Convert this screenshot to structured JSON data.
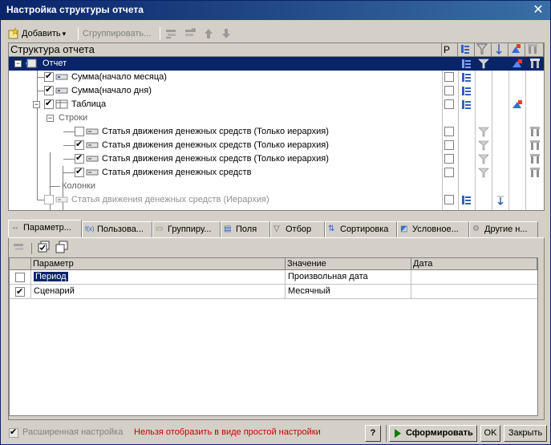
{
  "window": {
    "title": "Настройка структуры отчета",
    "close_glyph": "✕"
  },
  "toolbar": {
    "add_label": "Добавить",
    "add_arrow": "▾",
    "group_label": "Сгруппировать..."
  },
  "tree": {
    "header": {
      "title": "Структура отчета",
      "col_r": "Р"
    },
    "rows": [
      {
        "label": "Отчет",
        "level": 0,
        "checked": null,
        "selected": true
      },
      {
        "label": "Сумма(начало месяца)",
        "level": 1,
        "checked": true
      },
      {
        "label": "Сумма(начало дня)",
        "level": 1,
        "checked": true
      },
      {
        "label": "Таблица",
        "level": 1,
        "checked": true
      },
      {
        "label": "Строки",
        "level": 2,
        "checked": null
      },
      {
        "label": "Статья движения денежных средств (Только иерархия)",
        "level": 3,
        "checked": false
      },
      {
        "label": "Статья движения денежных средств (Только иерархия)",
        "level": 3,
        "checked": true
      },
      {
        "label": "Статья движения денежных средств (Только иерархия)",
        "level": 3,
        "checked": true
      },
      {
        "label": "Статья движения денежных средств",
        "level": 3,
        "checked": true
      },
      {
        "label": "Колонки",
        "level": 2,
        "checked": null
      },
      {
        "label": "Статья движения денежных средств (Иерархия)",
        "level": 1,
        "checked": false,
        "disabled": true
      }
    ]
  },
  "tabs": [
    {
      "label": "Параметр...",
      "icon": "↔"
    },
    {
      "label": "Пользова...",
      "icon": "f(x)"
    },
    {
      "label": "Группиру...",
      "icon": "▭"
    },
    {
      "label": "Поля",
      "icon": "▤"
    },
    {
      "label": "Отбор",
      "icon": "▽"
    },
    {
      "label": "Сортировка",
      "icon": "⇅"
    },
    {
      "label": "Условное...",
      "icon": "◩"
    },
    {
      "label": "Другие н...",
      "icon": "⚙"
    }
  ],
  "params": {
    "columns": [
      "Параметр",
      "Значение",
      "Дата"
    ],
    "rows": [
      {
        "checked": false,
        "name": "Период",
        "value": "Произвольная дата",
        "date": ""
      },
      {
        "checked": true,
        "name": "Сценарий",
        "value": "Месячный",
        "date": ""
      }
    ]
  },
  "footer": {
    "advanced_label": "Расширенная настройка",
    "warning": "Нельзя отобразить в виде простой настройки",
    "help": "?",
    "generate": "Сформировать",
    "ok": "OK",
    "close": "Закрыть"
  },
  "colors": {
    "title_bar": "#0a246a",
    "warning": "#cc0000",
    "generate_arrow": "#008000",
    "selection": "#0a246a"
  }
}
